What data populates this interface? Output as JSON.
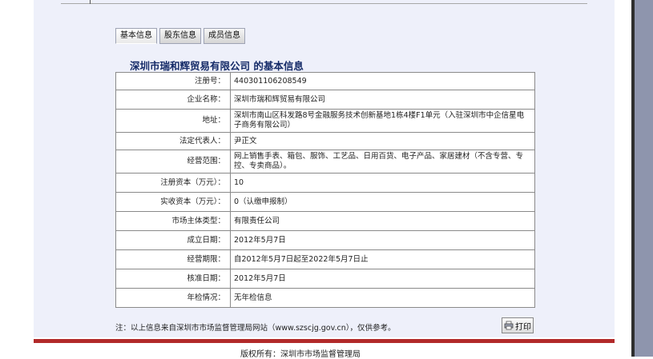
{
  "tabs": [
    {
      "label": "基本信息",
      "active": true
    },
    {
      "label": "股东信息",
      "active": false
    },
    {
      "label": "成员信息",
      "active": false
    }
  ],
  "title": "深圳市瑞和辉贸易有限公司 的基本信息",
  "rows": [
    {
      "label": "注册号：",
      "value": "440301106208549"
    },
    {
      "label": "企业名称：",
      "value": "深圳市瑞和辉贸易有限公司"
    },
    {
      "label": "地址：",
      "value": "深圳市南山区科发路8号金融服务技术创新基地1栋4楼F1单元（入驻深圳市中企信星电子商务有限公司）"
    },
    {
      "label": "法定代表人：",
      "value": "尹正文"
    },
    {
      "label": "经营范围：",
      "value": "网上销售手表、箱包、服饰、工艺品、日用百货、电子产品、家居建材（不含专营、专控、专卖商品）。"
    },
    {
      "label": "注册资本（万元）：",
      "value": "10"
    },
    {
      "label": "实收资本（万元）：",
      "value": "0（认缴申报制）"
    },
    {
      "label": "市场主体类型：",
      "value": "有限责任公司"
    },
    {
      "label": "成立日期：",
      "value": "2012年5月7日"
    },
    {
      "label": "经营期限：",
      "value": "自2012年5月7日起至2022年5月7日止"
    },
    {
      "label": "核准日期：",
      "value": "2012年5月7日"
    },
    {
      "label": "年检情况：",
      "value": "无年检信息"
    }
  ],
  "note": "注：以上信息来自深圳市市场监督管理局网站（www.szscjg.gov.cn），仅供参考。",
  "print_label": "打印",
  "copyright": "版权所有：深圳市市场监督管理局",
  "colors": {
    "title": "#142a67",
    "footer_bar": "#b22a2a",
    "right_bar": "#8e95ad"
  }
}
